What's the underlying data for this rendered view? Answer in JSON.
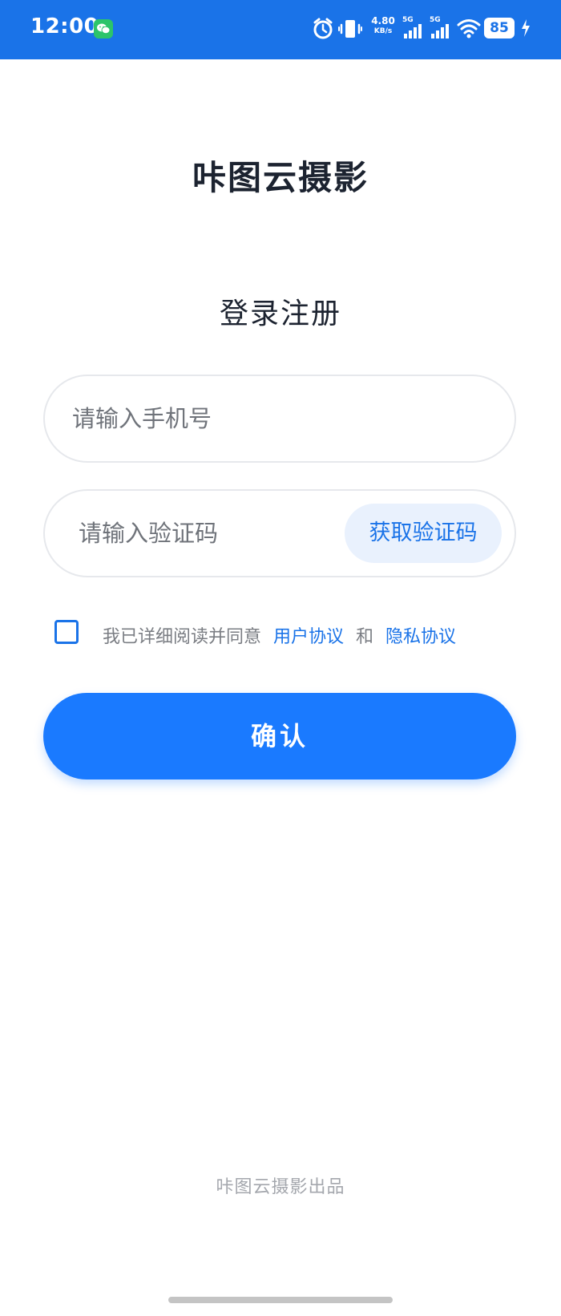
{
  "status_bar": {
    "time": "12:00",
    "net_speed_value": "4.80",
    "net_speed_unit": "KB/s",
    "sim1_label": "5G",
    "sim2_label": "5G",
    "battery": "85",
    "icons": [
      "wechat-icon",
      "alarm-icon",
      "vibrate-icon",
      "signal-icon",
      "wifi-icon",
      "battery-icon",
      "charging-icon"
    ],
    "colors": {
      "background": "#1a73e8",
      "foreground": "#ffffff"
    }
  },
  "app": {
    "title": "咔图云摄影"
  },
  "login": {
    "title": "登录注册",
    "phone_placeholder": "请输入手机号",
    "phone_value": "",
    "code_placeholder": "请输入验证码",
    "code_value": "",
    "get_code_label": "获取验证码",
    "agree_prefix": "我已详细阅读并同意",
    "user_agreement": "用户协议",
    "and_text": "和",
    "privacy_policy": "隐私协议",
    "agree_checked": false,
    "confirm_label": "确认"
  },
  "footer": {
    "text": "咔图云摄影出品"
  },
  "colors": {
    "accent": "#1a7aff",
    "link": "#1a73e8",
    "title_text": "#1c2330",
    "muted_text": "#7a7d83",
    "footer_text": "#a4a7ad"
  }
}
